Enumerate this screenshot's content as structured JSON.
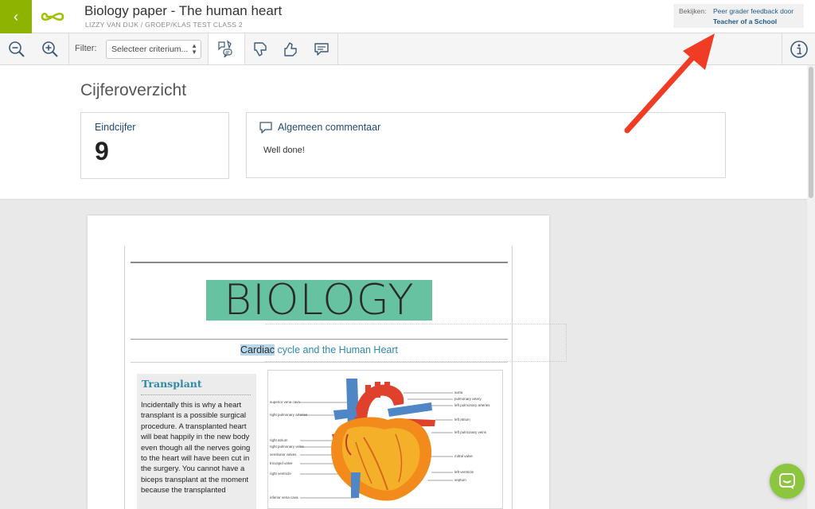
{
  "header": {
    "back_icon": "chevron-left-icon",
    "logo_icon": "infinity-logo",
    "title": "Biology paper - The human heart",
    "subtitle": "LIZZY VAN DIJK / GROEP/KLAS TEST CLASS 2",
    "view_label": "Bekijken:",
    "view_line1": "Peer grader feedback door",
    "view_line2": "Teacher of a School"
  },
  "toolbar": {
    "zoom_out_icon": "zoom-out-icon",
    "zoom_in_icon": "zoom-in-icon",
    "filter_label": "Filter:",
    "filter_value": "Selecteer criterium...",
    "icons": [
      "feedback-bubbles-icon",
      "thumbs-down-icon",
      "thumbs-up-icon",
      "comment-icon"
    ],
    "info_icon": "info-icon"
  },
  "overview": {
    "title": "Cijferoverzicht",
    "grade_label": "Eindcijfer",
    "grade_value": "9",
    "comment_label": "Algemeen commentaar",
    "comment_text": "Well done!"
  },
  "document": {
    "big_title": "BIOLOGY",
    "subtitle_highlight": "Cardiac",
    "subtitle_rest": " cycle and the Human Heart",
    "sidebar_title": "Transplant",
    "sidebar_text": "Incidentally this is why a heart transplant is a possible surgical procedure.  A transplanted heart will beat happily in the new body even though all the nerves going to the heart will have been cut in the surgery. You cannot have a biceps transplant at the moment because the transplanted",
    "figure_labels_left": [
      "superior vena cava",
      "right pulmonary arteries",
      "right atrium",
      "right pulmonary veins",
      "semilunar valves",
      "tricuspid valve",
      "right ventricle",
      "inferior vena cava"
    ],
    "figure_labels_right": [
      "aorta",
      "pulmonary artery",
      "left pulmonary arteries",
      "left atrium",
      "left pulmonary veins",
      "mitral valve",
      "left ventricle",
      "septum"
    ]
  },
  "colors": {
    "brand_green": "#8cb400",
    "highlight_teal": "#66c2a0",
    "link_blue": "#2d8aaa",
    "arrow_red": "#f03c24"
  }
}
